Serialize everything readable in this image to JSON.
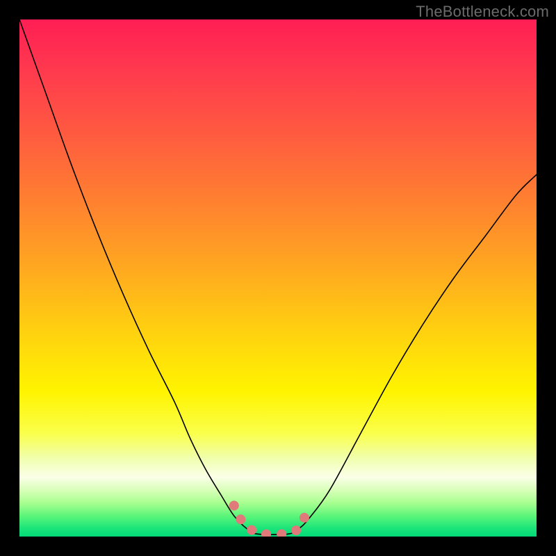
{
  "watermark": "TheBottleneck.com",
  "chart_data": {
    "type": "line",
    "title": "",
    "xlabel": "",
    "ylabel": "",
    "xlim": [
      0,
      100
    ],
    "ylim": [
      0,
      100
    ],
    "grid": false,
    "legend": false,
    "annotations": [],
    "series": [
      {
        "name": "curve",
        "x": [
          0,
          5,
          10,
          15,
          20,
          25,
          30,
          33,
          36,
          39,
          41.5,
          44,
          46,
          52,
          54,
          56,
          60,
          66,
          72,
          78,
          84,
          90,
          96,
          100
        ],
        "y": [
          100,
          86,
          72,
          59,
          47,
          36,
          26,
          19,
          13,
          8,
          4,
          1.5,
          0.5,
          0.5,
          1.5,
          3.5,
          9,
          20,
          31,
          41,
          50,
          58,
          66,
          70
        ],
        "stroke": "#000000",
        "stroke_width": 1.6
      },
      {
        "name": "highlight-segment",
        "x": [
          41.5,
          43,
          45,
          47,
          50,
          52,
          53.5,
          54.5,
          56
        ],
        "y": [
          6,
          3,
          1.2,
          0.5,
          0.5,
          0.5,
          1.2,
          2.5,
          5.5
        ],
        "stroke": "#e07a7a",
        "stroke_width": 14,
        "dotted": true
      }
    ],
    "background_gradient": {
      "type": "vertical",
      "stops": [
        {
          "offset": 0.0,
          "color": "#ff1e54"
        },
        {
          "offset": 0.1,
          "color": "#ff3a4e"
        },
        {
          "offset": 0.22,
          "color": "#ff5a40"
        },
        {
          "offset": 0.35,
          "color": "#ff8030"
        },
        {
          "offset": 0.48,
          "color": "#ffa820"
        },
        {
          "offset": 0.6,
          "color": "#ffd010"
        },
        {
          "offset": 0.72,
          "color": "#fff400"
        },
        {
          "offset": 0.8,
          "color": "#faff4a"
        },
        {
          "offset": 0.85,
          "color": "#f0ffb0"
        },
        {
          "offset": 0.885,
          "color": "#fbffe8"
        },
        {
          "offset": 0.91,
          "color": "#d8ffb8"
        },
        {
          "offset": 0.935,
          "color": "#a8ff90"
        },
        {
          "offset": 0.96,
          "color": "#5cf57a"
        },
        {
          "offset": 0.985,
          "color": "#18e47a"
        },
        {
          "offset": 1.0,
          "color": "#04d878"
        }
      ]
    }
  }
}
